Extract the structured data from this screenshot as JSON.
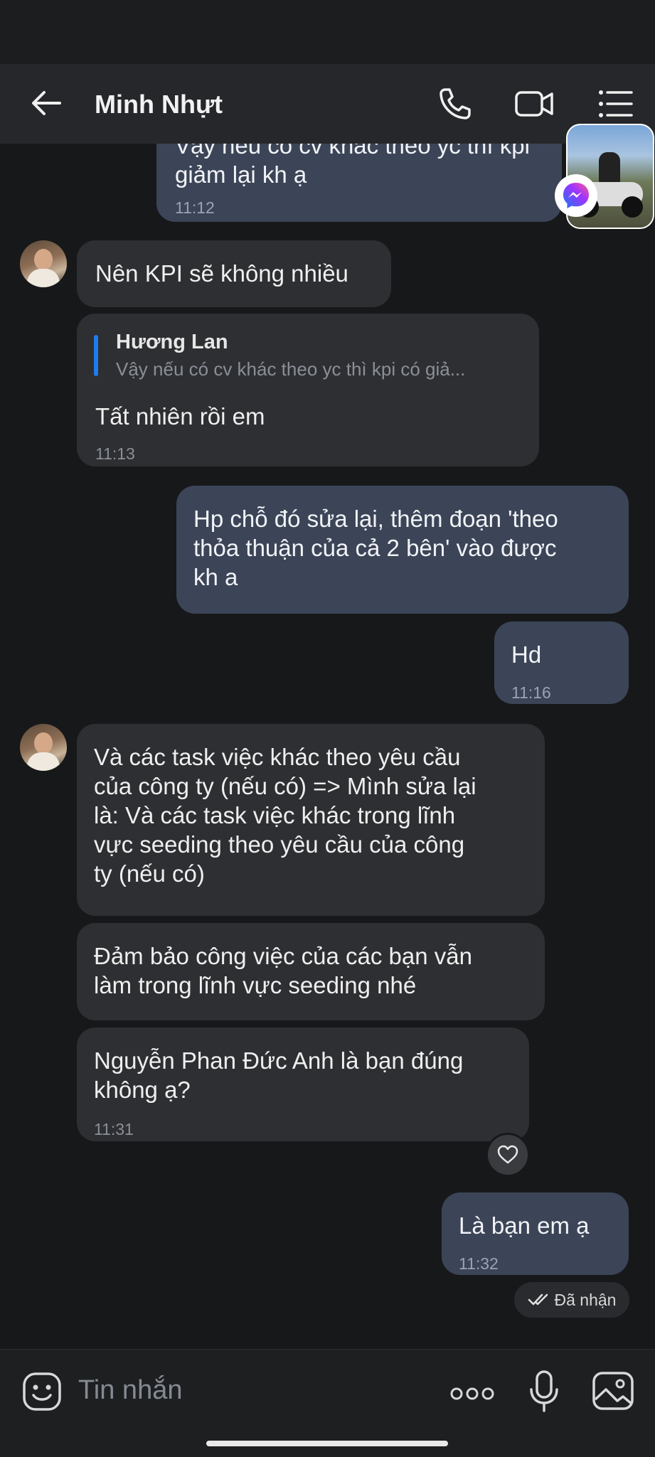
{
  "header": {
    "title": "Minh Nhựt"
  },
  "messages": [
    {
      "side": "out",
      "lines": [
        "Vậy nếu có cv khác theo yc thì kpi",
        "giảm lại kh ạ"
      ],
      "time": "11:12"
    },
    {
      "side": "in",
      "lines": [
        "Nên KPI sẽ không nhiều"
      ]
    },
    {
      "side": "in",
      "reply_to": {
        "name": "Hương Lan",
        "text": "Vậy nếu có cv khác theo yc thì kpi có giả..."
      },
      "lines": [
        "Tất nhiên rồi em"
      ],
      "time": "11:13"
    },
    {
      "side": "out",
      "lines": [
        "Hp chỗ đó sửa lại, thêm đoạn 'theo",
        "thỏa thuận của cả 2 bên' vào được",
        "kh a"
      ]
    },
    {
      "side": "out",
      "lines": [
        "Hd"
      ],
      "time": "11:16"
    },
    {
      "side": "in",
      "lines": [
        "Và các task việc khác theo yêu cầu",
        "của công ty (nếu có) => Mình sửa lại",
        "là: Và các task việc khác trong lĩnh",
        "vực seeding theo yêu cầu của công",
        "ty (nếu có)"
      ]
    },
    {
      "side": "in",
      "lines": [
        "Đảm bảo công việc của các bạn vẫn",
        "làm trong lĩnh vực seeding nhé"
      ]
    },
    {
      "side": "in",
      "lines": [
        "Nguyễn Phan Đức Anh là bạn đúng",
        "không ạ?"
      ],
      "time": "11:31"
    },
    {
      "side": "out",
      "lines": [
        "Là bạn em ạ"
      ],
      "time": "11:32"
    }
  ],
  "status": {
    "received": "Đã nhận"
  },
  "input": {
    "placeholder": "Tin nhắn"
  },
  "icons": {
    "back": "arrow-left-icon",
    "call": "phone-icon",
    "video": "video-camera-icon",
    "menu": "list-menu-icon",
    "emoji": "emoji-icon",
    "more": "more-dots-icon",
    "mic": "microphone-icon",
    "gallery": "image-icon",
    "reaction": "heart-icon",
    "check": "double-check-icon",
    "messenger": "messenger-icon"
  },
  "colors": {
    "incoming_bubble": "#2e2f32",
    "outgoing_bubble": "#3c4557",
    "quote_accent": "#1f7cf0",
    "background": "#17181a"
  }
}
